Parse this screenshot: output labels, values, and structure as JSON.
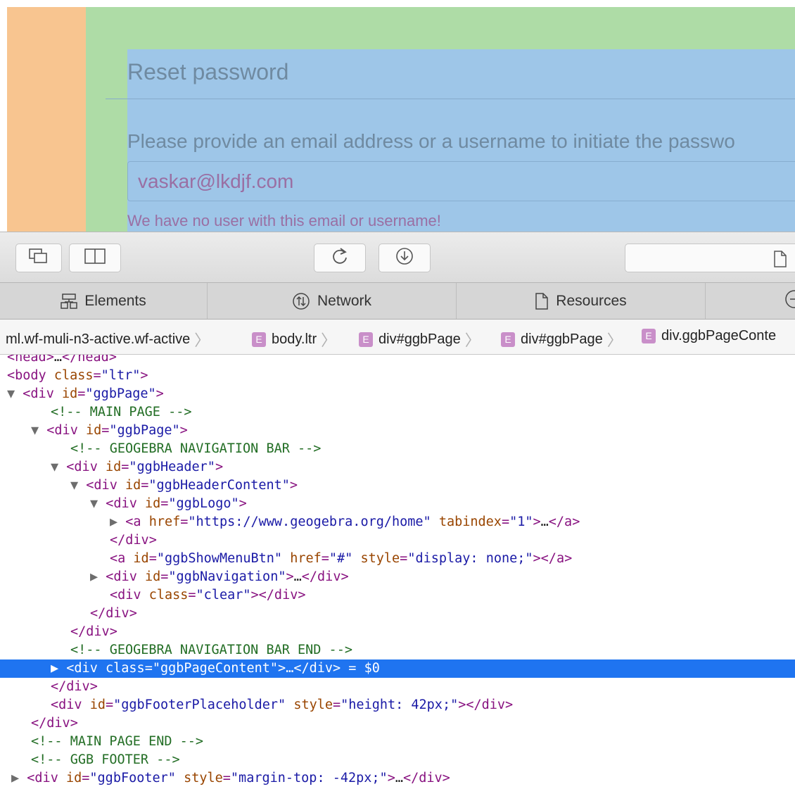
{
  "preview": {
    "title": "Reset password",
    "instruction": "Please provide an email address or a username to initiate the passwo",
    "email_value": "vaskar@lkdjf.com",
    "error": "We have no user with this email or username!"
  },
  "toolbar": {
    "buttons": [
      "dock-undock",
      "split-view",
      "reload",
      "download"
    ]
  },
  "tabs": [
    "Elements",
    "Network",
    "Resources"
  ],
  "breadcrumb": {
    "root": "ml.wf-muli-n3-active.wf-active",
    "items": [
      "body.ltr",
      "div#ggbPage",
      "div#ggbPage",
      "div.ggbPageConte"
    ],
    "badge": "E"
  },
  "tree": [
    {
      "indent": 10,
      "tri": "",
      "parts": [
        [
          "tg",
          "<head>"
        ],
        [
          "tx",
          "…"
        ],
        [
          "tg",
          "</head>"
        ]
      ]
    },
    {
      "indent": 10,
      "tri": "",
      "parts": [
        [
          "tg",
          "<body "
        ],
        [
          "at",
          "class"
        ],
        [
          "tg",
          "="
        ],
        [
          "av",
          "\"ltr\""
        ],
        [
          "tg",
          ">"
        ]
      ]
    },
    {
      "indent": 10,
      "tri": "▼ ",
      "parts": [
        [
          "tg",
          "<div "
        ],
        [
          "at",
          "id"
        ],
        [
          "tg",
          "="
        ],
        [
          "av",
          "\"ggbPage\""
        ],
        [
          "tg",
          ">"
        ]
      ]
    },
    {
      "indent": 72,
      "tri": "",
      "parts": [
        [
          "cm",
          "<!-- MAIN PAGE -->"
        ]
      ]
    },
    {
      "indent": 44,
      "tri": "▼ ",
      "parts": [
        [
          "tg",
          "<div "
        ],
        [
          "at",
          "id"
        ],
        [
          "tg",
          "="
        ],
        [
          "av",
          "\"ggbPage\""
        ],
        [
          "tg",
          ">"
        ]
      ]
    },
    {
      "indent": 100,
      "tri": "",
      "parts": [
        [
          "cm",
          "<!-- GEOGEBRA NAVIGATION BAR -->"
        ]
      ]
    },
    {
      "indent": 72,
      "tri": "▼ ",
      "parts": [
        [
          "tg",
          "<div "
        ],
        [
          "at",
          "id"
        ],
        [
          "tg",
          "="
        ],
        [
          "av",
          "\"ggbHeader\""
        ],
        [
          "tg",
          ">"
        ]
      ]
    },
    {
      "indent": 100,
      "tri": "▼ ",
      "parts": [
        [
          "tg",
          "<div "
        ],
        [
          "at",
          "id"
        ],
        [
          "tg",
          "="
        ],
        [
          "av",
          "\"ggbHeaderContent\""
        ],
        [
          "tg",
          ">"
        ]
      ]
    },
    {
      "indent": 128,
      "tri": "▼ ",
      "parts": [
        [
          "tg",
          "<div "
        ],
        [
          "at",
          "id"
        ],
        [
          "tg",
          "="
        ],
        [
          "av",
          "\"ggbLogo\""
        ],
        [
          "tg",
          ">"
        ]
      ]
    },
    {
      "indent": 156,
      "tri": "▶ ",
      "parts": [
        [
          "tg",
          "<a "
        ],
        [
          "at",
          "href"
        ],
        [
          "tg",
          "="
        ],
        [
          "av",
          "\"https://www.geogebra.org/home\""
        ],
        [
          "tg",
          " "
        ],
        [
          "at",
          "tabindex"
        ],
        [
          "tg",
          "="
        ],
        [
          "av",
          "\"1\""
        ],
        [
          "tg",
          ">"
        ],
        [
          "tx",
          "…"
        ],
        [
          "tg",
          "</a>"
        ]
      ]
    },
    {
      "indent": 156,
      "tri": "",
      "parts": [
        [
          "tg",
          "</div>"
        ]
      ]
    },
    {
      "indent": 156,
      "tri": "",
      "parts": [
        [
          "tg",
          "<a "
        ],
        [
          "at",
          "id"
        ],
        [
          "tg",
          "="
        ],
        [
          "av",
          "\"ggbShowMenuBtn\""
        ],
        [
          "tg",
          " "
        ],
        [
          "at",
          "href"
        ],
        [
          "tg",
          "="
        ],
        [
          "av",
          "\"#\""
        ],
        [
          "tg",
          " "
        ],
        [
          "at",
          "style"
        ],
        [
          "tg",
          "="
        ],
        [
          "av",
          "\"display: none;\""
        ],
        [
          "tg",
          "></a>"
        ]
      ]
    },
    {
      "indent": 128,
      "tri": "▶ ",
      "parts": [
        [
          "tg",
          "<div "
        ],
        [
          "at",
          "id"
        ],
        [
          "tg",
          "="
        ],
        [
          "av",
          "\"ggbNavigation\""
        ],
        [
          "tg",
          ">"
        ],
        [
          "tx",
          "…"
        ],
        [
          "tg",
          "</div>"
        ]
      ]
    },
    {
      "indent": 156,
      "tri": "",
      "parts": [
        [
          "tg",
          "<div "
        ],
        [
          "at",
          "class"
        ],
        [
          "tg",
          "="
        ],
        [
          "av",
          "\"clear\""
        ],
        [
          "tg",
          "></div>"
        ]
      ]
    },
    {
      "indent": 128,
      "tri": "",
      "parts": [
        [
          "tg",
          "</div>"
        ]
      ]
    },
    {
      "indent": 100,
      "tri": "",
      "parts": [
        [
          "tg",
          "</div>"
        ]
      ]
    },
    {
      "indent": 100,
      "tri": "",
      "parts": [
        [
          "cm",
          "<!-- GEOGEBRA NAVIGATION BAR END -->"
        ]
      ]
    },
    {
      "indent": 72,
      "tri": "▶ ",
      "selected": true,
      "parts": [
        [
          "tg",
          "<div "
        ],
        [
          "at",
          "class"
        ],
        [
          "tg",
          "="
        ],
        [
          "av",
          "\"ggbPageContent\""
        ],
        [
          "tg",
          ">"
        ],
        [
          "tx",
          "…"
        ],
        [
          "tg",
          "</div>"
        ],
        [
          "tx",
          " = $0"
        ]
      ]
    },
    {
      "indent": 72,
      "tri": "",
      "parts": [
        [
          "tg",
          "</div>"
        ]
      ]
    },
    {
      "indent": 72,
      "tri": "",
      "parts": [
        [
          "tg",
          "<div "
        ],
        [
          "at",
          "id"
        ],
        [
          "tg",
          "="
        ],
        [
          "av",
          "\"ggbFooterPlaceholder\""
        ],
        [
          "tg",
          " "
        ],
        [
          "at",
          "style"
        ],
        [
          "tg",
          "="
        ],
        [
          "av",
          "\"height: 42px;\""
        ],
        [
          "tg",
          "></div>"
        ]
      ]
    },
    {
      "indent": 44,
      "tri": "",
      "parts": [
        [
          "tg",
          "</div>"
        ]
      ]
    },
    {
      "indent": 44,
      "tri": "",
      "parts": [
        [
          "cm",
          "<!-- MAIN PAGE END -->"
        ]
      ]
    },
    {
      "indent": 44,
      "tri": "",
      "parts": [
        [
          "cm",
          "<!-- GGB FOOTER -->"
        ]
      ]
    },
    {
      "indent": 16,
      "tri": "▶ ",
      "parts": [
        [
          "tg",
          "<div "
        ],
        [
          "at",
          "id"
        ],
        [
          "tg",
          "="
        ],
        [
          "av",
          "\"ggbFooter\""
        ],
        [
          "tg",
          " "
        ],
        [
          "at",
          "style"
        ],
        [
          "tg",
          "="
        ],
        [
          "av",
          "\"margin-top: -42px;\""
        ],
        [
          "tg",
          ">"
        ],
        [
          "tx",
          "…"
        ],
        [
          "tg",
          "</div>"
        ]
      ]
    }
  ]
}
